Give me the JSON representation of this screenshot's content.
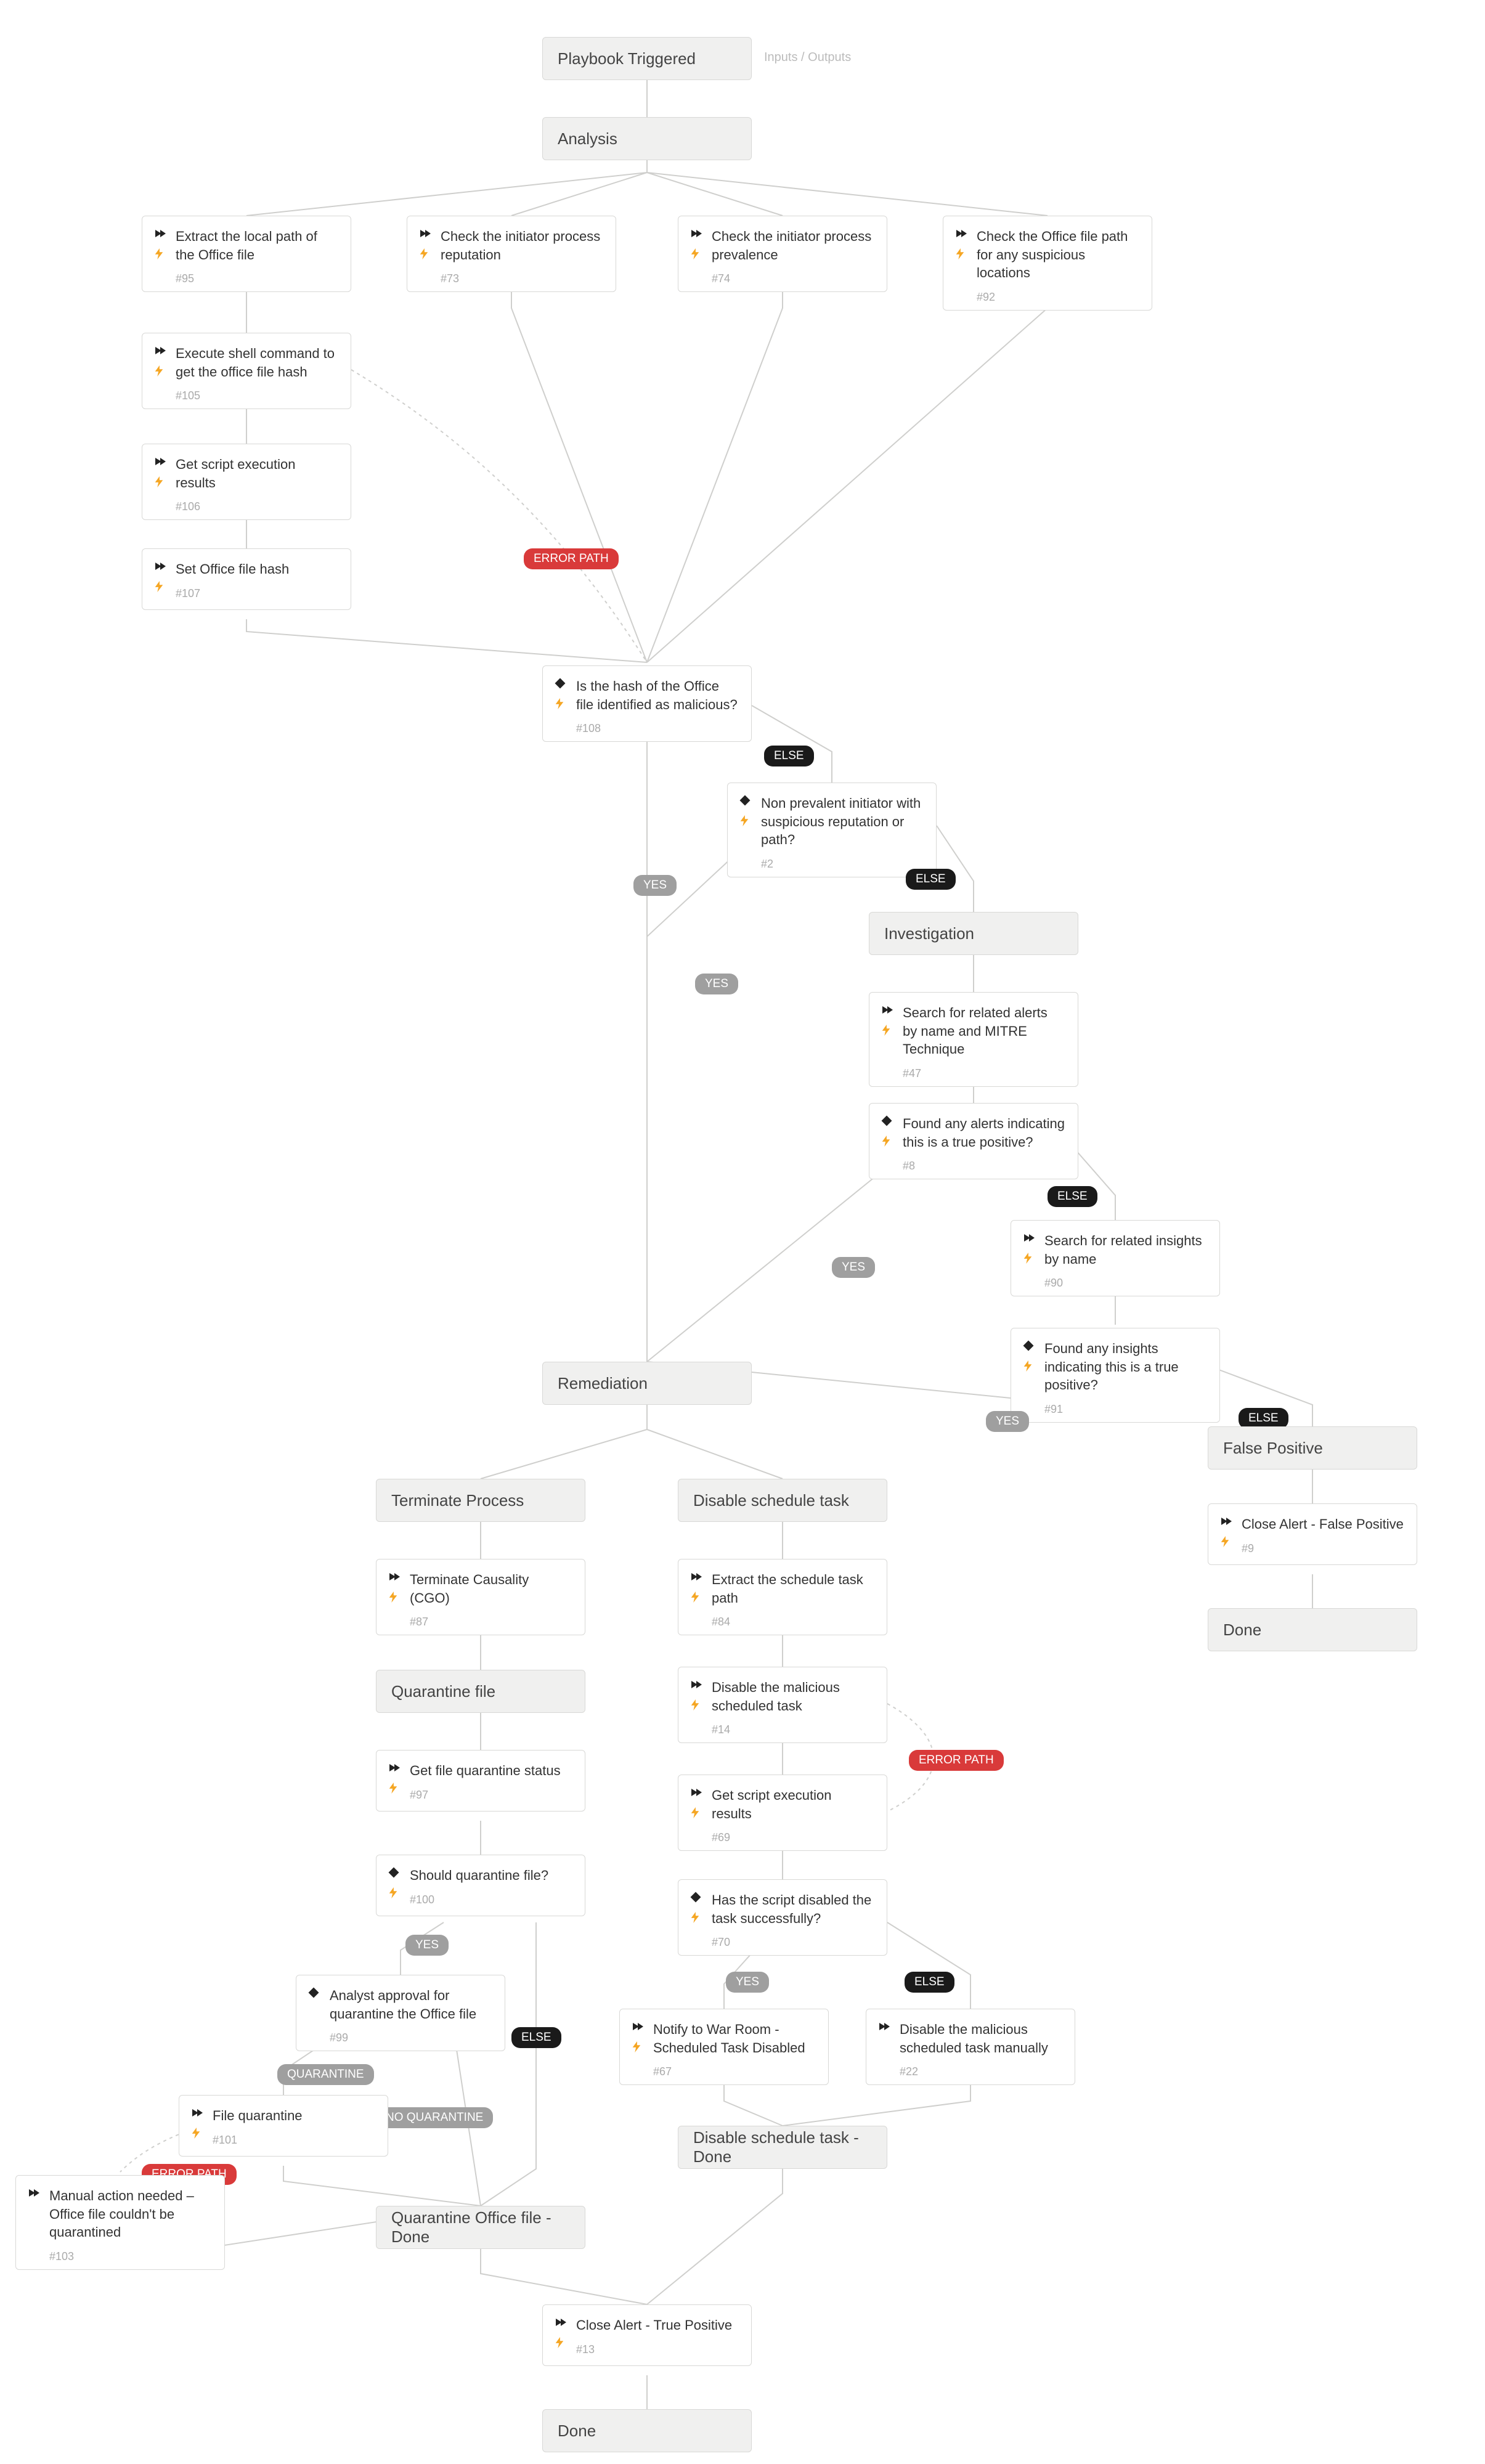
{
  "io_label": "Inputs / Outputs",
  "badges": {
    "yes": "YES",
    "else": "ELSE",
    "error": "ERROR PATH",
    "quarantine": "QUARANTINE",
    "no_quarantine": "NO QUARANTINE"
  },
  "headers": {
    "playbook_triggered": "Playbook Triggered",
    "analysis": "Analysis",
    "investigation": "Investigation",
    "remediation": "Remediation",
    "false_positive": "False Positive",
    "terminate_process": "Terminate Process",
    "disable_schedule_task": "Disable schedule task",
    "quarantine_file": "Quarantine file",
    "disable_done": "Disable schedule task - Done",
    "quarantine_done": "Quarantine Office file - Done",
    "done_fp": "Done",
    "done_final": "Done"
  },
  "tasks": {
    "t95": {
      "title": "Extract the local path of the Office file",
      "ref": "#95",
      "kind": "action"
    },
    "t73": {
      "title": "Check the initiator process reputation",
      "ref": "#73",
      "kind": "action"
    },
    "t74": {
      "title": "Check the initiator process prevalence",
      "ref": "#74",
      "kind": "action"
    },
    "t92": {
      "title": "Check the Office file path for any suspicious locations",
      "ref": "#92",
      "kind": "action"
    },
    "t105": {
      "title": "Execute shell command to get the office file hash",
      "ref": "#105",
      "kind": "action"
    },
    "t106": {
      "title": "Get script execution results",
      "ref": "#106",
      "kind": "action"
    },
    "t107": {
      "title": "Set Office file hash",
      "ref": "#107",
      "kind": "action"
    },
    "t108": {
      "title": "Is the hash of the Office file identified as malicious?",
      "ref": "#108",
      "kind": "condition"
    },
    "t2": {
      "title": "Non prevalent initiator with suspicious reputation or path?",
      "ref": "#2",
      "kind": "condition"
    },
    "t47": {
      "title": "Search for related alerts by name and MITRE Technique",
      "ref": "#47",
      "kind": "action"
    },
    "t8": {
      "title": "Found any alerts indicating this is a true positive?",
      "ref": "#8",
      "kind": "condition"
    },
    "t90": {
      "title": "Search for related insights by name",
      "ref": "#90",
      "kind": "action"
    },
    "t91": {
      "title": "Found any insights indicating this is a true positive?",
      "ref": "#91",
      "kind": "condition"
    },
    "t9": {
      "title": "Close Alert - False Positive",
      "ref": "#9",
      "kind": "action"
    },
    "t87": {
      "title": "Terminate Causality (CGO)",
      "ref": "#87",
      "kind": "action"
    },
    "t84": {
      "title": "Extract the schedule task path",
      "ref": "#84",
      "kind": "action"
    },
    "t14": {
      "title": "Disable the malicious scheduled task",
      "ref": "#14",
      "kind": "action"
    },
    "t69": {
      "title": "Get script execution results",
      "ref": "#69",
      "kind": "action"
    },
    "t70": {
      "title": "Has the script disabled the task successfully?",
      "ref": "#70",
      "kind": "condition"
    },
    "t67": {
      "title": "Notify to War Room - Scheduled Task Disabled",
      "ref": "#67",
      "kind": "action"
    },
    "t22": {
      "title": "Disable the malicious scheduled task manually",
      "ref": "#22",
      "kind": "action"
    },
    "t97": {
      "title": "Get file quarantine status",
      "ref": "#97",
      "kind": "action"
    },
    "t100": {
      "title": "Should quarantine file?",
      "ref": "#100",
      "kind": "condition"
    },
    "t99": {
      "title": "Analyst approval for quarantine the Office file",
      "ref": "#99",
      "kind": "condition"
    },
    "t101": {
      "title": "File quarantine",
      "ref": "#101",
      "kind": "action"
    },
    "t103": {
      "title": "Manual action needed – Office file couldn't be quarantined",
      "ref": "#103",
      "kind": "action"
    },
    "t13": {
      "title": "Close Alert - True Positive",
      "ref": "#13",
      "kind": "action"
    }
  }
}
